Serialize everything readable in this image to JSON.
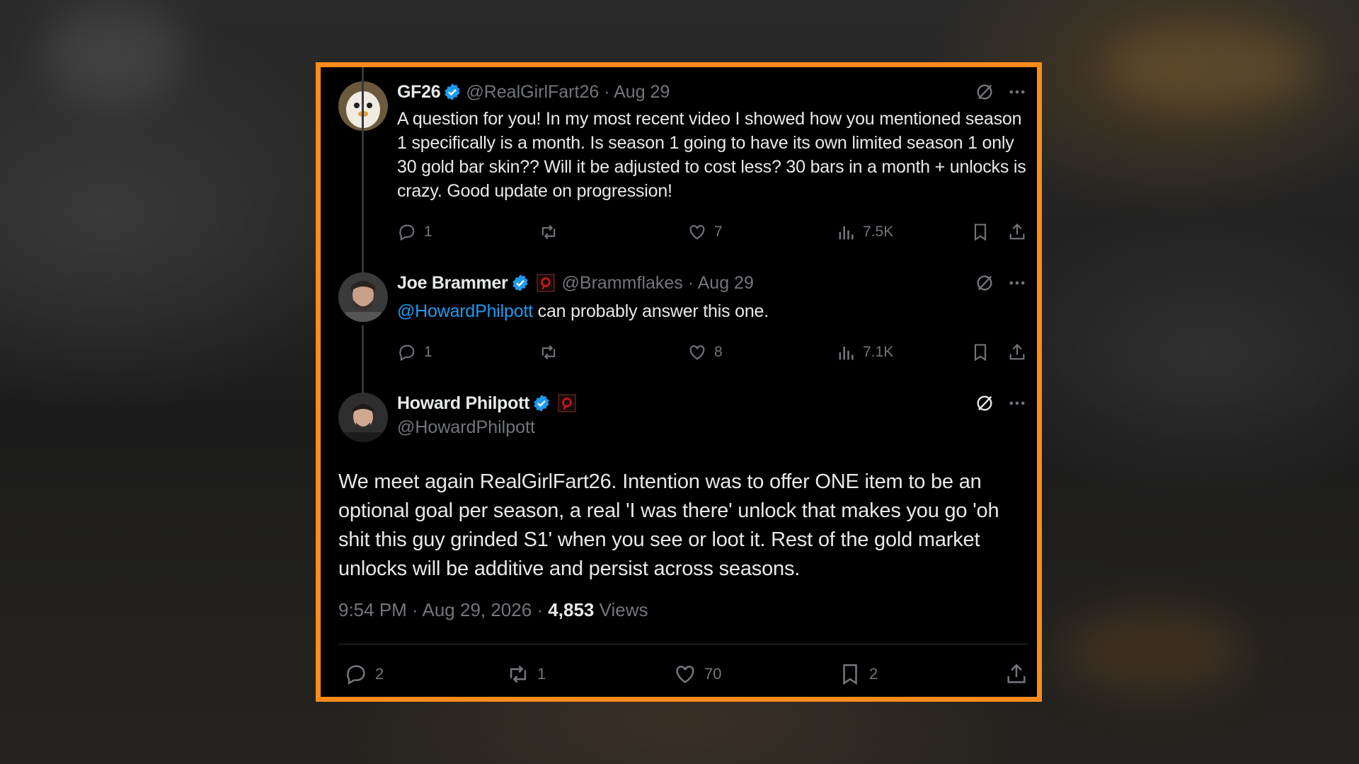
{
  "tweets": [
    {
      "name": "GF26",
      "handle": "@RealGirlFart26",
      "date": "· Aug 29",
      "text": "A question for you! In my most recent video I showed how you mentioned season 1 specifically is a month. Is season 1 going to have its own limited season 1 only 30 gold bar skin?? Will it be adjusted to cost less? 30 bars in a month + unlocks is crazy. Good update on progression!",
      "replies": "1",
      "reposts": "",
      "likes": "7",
      "views": "7.5K"
    },
    {
      "name": "Joe Brammer",
      "handle": "@Brammflakes",
      "date": "· Aug 29",
      "mention": "@HowardPhilpott",
      "text": " can probably answer this one.",
      "replies": "1",
      "reposts": "",
      "likes": "8",
      "views": "7.1K"
    }
  ],
  "main_tweet": {
    "name": "Howard Philpott",
    "handle": "@HowardPhilpott",
    "text": "We meet again RealGirlFart26. Intention was to offer ONE item to be an optional goal per season, a real 'I was there' unlock that makes you go 'oh shit this guy grinded S1' when you see or loot it. Rest of the gold market unlocks will be additive and persist across seasons.",
    "timestamp": "9:54 PM · Aug 29, 2026 · ",
    "views_count": "4,853",
    "views_label": " Views",
    "replies": "2",
    "reposts": "1",
    "likes": "70",
    "bookmarks": "2"
  },
  "icons": [
    "verified-badge-icon",
    "affiliate-badge-icon",
    "grok-icon",
    "more-icon",
    "reply-icon",
    "repost-icon",
    "like-icon",
    "views-icon",
    "bookmark-icon",
    "share-icon"
  ],
  "colors": {
    "frame": "#ff8c1a",
    "verified": "#1d9bf0",
    "link": "#1d9bf0",
    "text": "#e7e9ea",
    "muted": "#71767b",
    "affiliate": "#c4171d"
  }
}
